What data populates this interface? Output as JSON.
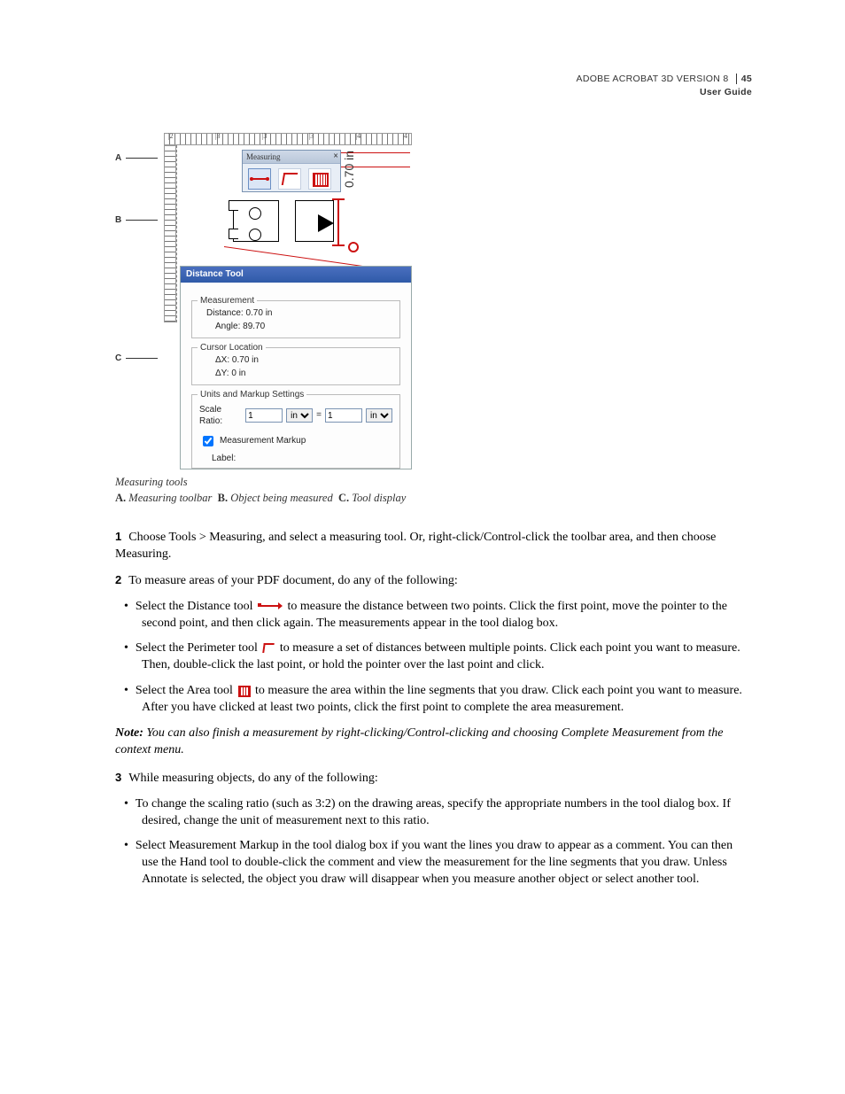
{
  "header": {
    "product": "ADOBE ACROBAT 3D VERSION 8",
    "subtitle": "User Guide",
    "page_number": "45"
  },
  "figure": {
    "callouts": {
      "A": "A",
      "B": "B",
      "C": "C"
    },
    "toolbar": {
      "title": "Measuring",
      "close": "×",
      "tools": [
        "Distance",
        "Perimeter",
        "Area"
      ]
    },
    "dimension_label": "0.70 in",
    "panel": {
      "title": "Distance Tool",
      "measurement": {
        "legend": "Measurement",
        "distance_label": "Distance:",
        "distance_value": "0.70 in",
        "angle_label": "Angle:",
        "angle_value": "89.70"
      },
      "cursor": {
        "legend": "Cursor Location",
        "dx_label": "ΔX:",
        "dx_value": "0.70 in",
        "dy_label": "ΔY:",
        "dy_value": "0 in"
      },
      "units": {
        "legend": "Units and Markup Settings",
        "scale_label": "Scale Ratio:",
        "left_val": "1",
        "left_unit": "in",
        "eq": "=",
        "right_val": "1",
        "right_unit": "in",
        "markup_label": "Measurement Markup",
        "label_label": "Label:"
      }
    },
    "caption_title": "Measuring tools",
    "caption_legend_a": "Measuring toolbar",
    "caption_legend_b": "Object being measured",
    "caption_legend_c": "Tool display"
  },
  "steps": {
    "s1_num": "1",
    "s1": "Choose Tools > Measuring, and select a measuring tool. Or, right-click/Control-click the toolbar area, and then choose Measuring.",
    "s2_num": "2",
    "s2": "To measure areas of your PDF document, do any of the following:",
    "s2a_pre": "Select the Distance tool ",
    "s2a_post": " to measure the distance between two points. Click the first point, move the pointer to the second point, and then click again. The measurements appear in the tool dialog box.",
    "s2b_pre": "Select the Perimeter tool ",
    "s2b_post": " to measure a set of distances between multiple points. Click each point you want to measure. Then, double-click the last point, or hold the pointer over the last point and click.",
    "s2c_pre": "Select the Area tool ",
    "s2c_post": " to measure the area within the line segments that you draw. Click each point you want to measure. After you have clicked at least two points, click the first point to complete the area measurement.",
    "note_label": "Note:",
    "note": " You can also finish a measurement by right-clicking/Control-clicking and choosing Complete Measurement from the context menu.",
    "s3_num": "3",
    "s3": "While measuring objects, do any of the following:",
    "s3a": "To change the scaling ratio (such as 3:2) on the drawing areas, specify the appropriate numbers in the tool dialog box. If desired, change the unit of measurement next to this ratio.",
    "s3b": "Select Measurement Markup in the tool dialog box if you want the lines you draw to appear as a comment. You can then use the Hand tool to double-click the comment and view the measurement for the line segments that you draw. Unless Annotate is selected, the object you draw will disappear when you measure another object or select another tool."
  }
}
